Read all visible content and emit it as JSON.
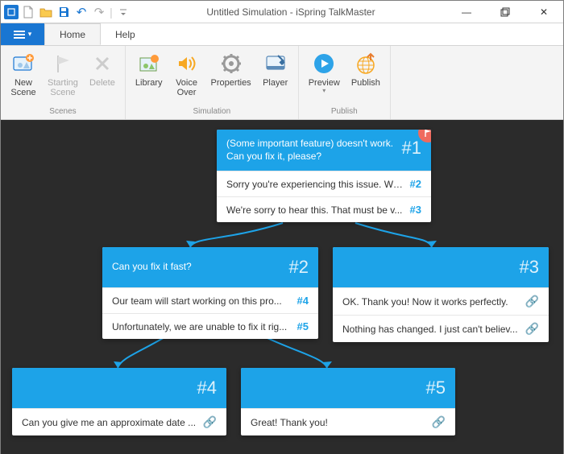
{
  "window": {
    "title": "Untitled Simulation - iSpring TalkMaster",
    "controls": {
      "min": "—",
      "max": "▭",
      "close": "✕"
    }
  },
  "qat": {
    "app_icon": "≡",
    "new": "new",
    "open": "open",
    "save": "save",
    "undo": "↶",
    "redo": "↷",
    "pipe": "|",
    "dropdown": "⁼"
  },
  "tabs": {
    "file_caret": "▾",
    "home": "Home",
    "help": "Help"
  },
  "ribbon": {
    "scenes": {
      "label": "Scenes",
      "new_scene": "New\nScene",
      "starting_scene": "Starting\nScene",
      "delete": "Delete"
    },
    "simulation": {
      "label": "Simulation",
      "library": "Library",
      "voice_over": "Voice\nOver",
      "properties": "Properties",
      "player": "Player"
    },
    "publish": {
      "label": "Publish",
      "preview": "Preview",
      "publish": "Publish"
    }
  },
  "nodes": {
    "n1": {
      "num": "#1",
      "question": "(Some important feature) doesn't work. Can you fix it, please?",
      "replies": [
        {
          "text": "Sorry you're experiencing this issue. We ...",
          "link": "#2"
        },
        {
          "text": "We're sorry to hear this. That must be v...",
          "link": "#3"
        }
      ]
    },
    "n2": {
      "num": "#2",
      "question": "Can you fix it fast?",
      "replies": [
        {
          "text": "Our team will start working on this pro...",
          "link": "#4"
        },
        {
          "text": "Unfortunately, we are unable to fix it rig...",
          "link": "#5"
        }
      ]
    },
    "n3": {
      "num": "#3",
      "question": "",
      "replies": [
        {
          "text": "OK. Thank you! Now it works perfectly.",
          "link_icon": true
        },
        {
          "text": "Nothing has changed. I just can't believ...",
          "link_icon": true
        }
      ]
    },
    "n4": {
      "num": "#4",
      "question": "",
      "replies": [
        {
          "text": "Can you give me an approximate date ...",
          "link_icon": true
        }
      ]
    },
    "n5": {
      "num": "#5",
      "question": "",
      "replies": [
        {
          "text": "Great! Thank you!",
          "link_icon": true
        }
      ]
    }
  }
}
